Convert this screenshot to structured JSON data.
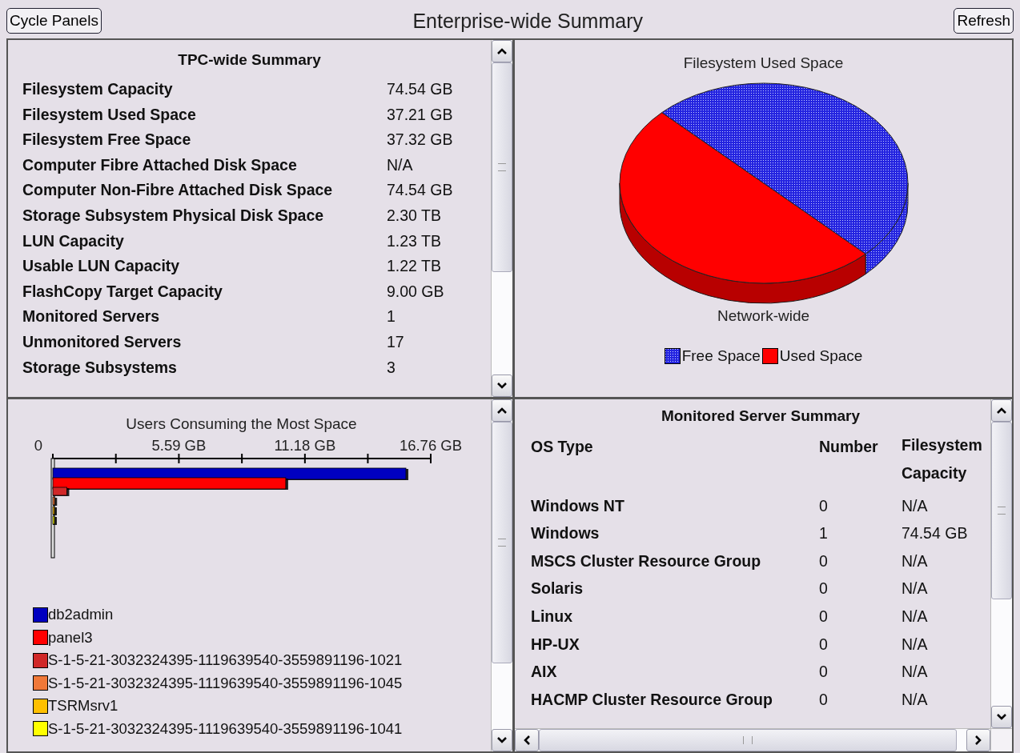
{
  "toolbar": {
    "left_button": "Cycle Panels",
    "title": "Enterprise-wide Summary",
    "right_button": "Refresh"
  },
  "tpc_summary": {
    "title": "TPC-wide Summary",
    "rows": [
      {
        "label": "Filesystem Capacity",
        "value": "74.54 GB"
      },
      {
        "label": "Filesystem Used Space",
        "value": "37.21 GB"
      },
      {
        "label": "Filesystem Free Space",
        "value": "37.32 GB"
      },
      {
        "label": "Computer Fibre Attached Disk Space",
        "value": "N/A"
      },
      {
        "label": "Computer Non-Fibre Attached Disk Space",
        "value": "74.54 GB"
      },
      {
        "label": "Storage Subsystem Physical Disk Space",
        "value": "2.30 TB"
      },
      {
        "label": "LUN Capacity",
        "value": "1.23 TB"
      },
      {
        "label": "Usable LUN Capacity",
        "value": "1.22 TB"
      },
      {
        "label": "FlashCopy Target Capacity",
        "value": "9.00 GB"
      },
      {
        "label": "Monitored Servers",
        "value": "1"
      },
      {
        "label": "Unmonitored Servers",
        "value": "17"
      },
      {
        "label": "Storage Subsystems",
        "value": "3"
      }
    ]
  },
  "filesystem_chart": {
    "title": "Filesystem Used Space",
    "label": "Network-wide",
    "legend": [
      {
        "label": "Free Space",
        "color": "#2424e0",
        "kind": "dotted"
      },
      {
        "label": "Used Space",
        "color": "#ff0000",
        "kind": "solid"
      }
    ]
  },
  "users_chart": {
    "chart_data": {
      "type": "bar",
      "orientation": "horizontal",
      "title": "Users Consuming the Most Space",
      "xlim": [
        0,
        16.76
      ],
      "xticks": [
        0,
        {
          "value": 5.59,
          "label": "5.59 GB"
        },
        {
          "value": 11.18,
          "label": "11.18 GB"
        },
        {
          "value": 16.76,
          "label": "16.76 GB"
        }
      ],
      "series": [
        {
          "name": "db2admin",
          "color": "#0000c0",
          "values": [
            15.66
          ]
        },
        {
          "name": "panel3",
          "color": "#ff0000",
          "values": [
            10.33
          ]
        },
        {
          "name": "S-1-5-21-3032324395-1119639540-3559891196-1021",
          "color": "#d02828",
          "values": [
            0.62
          ]
        },
        {
          "name": "S-1-5-21-3032324395-1119639540-3559891196-1045",
          "color": "#f07838",
          "values": [
            0.08
          ]
        },
        {
          "name": "TSRMsrv1",
          "color": "#ffc000",
          "values": [
            0.05
          ]
        },
        {
          "name": "S-1-5-21-3032324395-1119639540-3559891196-1041",
          "color": "#ffff00",
          "values": [
            0.04
          ]
        }
      ]
    }
  },
  "server_summary": {
    "title": "Monitored Server Summary",
    "columns": [
      "OS Type",
      "Number",
      "Filesystem Capacity"
    ],
    "rows": [
      [
        "Windows NT",
        "0",
        "N/A"
      ],
      [
        "Windows",
        "1",
        "74.54 GB"
      ],
      [
        "MSCS Cluster Resource Group",
        "0",
        "N/A"
      ],
      [
        "Solaris",
        "0",
        "N/A"
      ],
      [
        "Linux",
        "0",
        "N/A"
      ],
      [
        "HP-UX",
        "0",
        "N/A"
      ],
      [
        "AIX",
        "0",
        "N/A"
      ],
      [
        "HACMP Cluster Resource Group",
        "0",
        "N/A"
      ]
    ]
  }
}
